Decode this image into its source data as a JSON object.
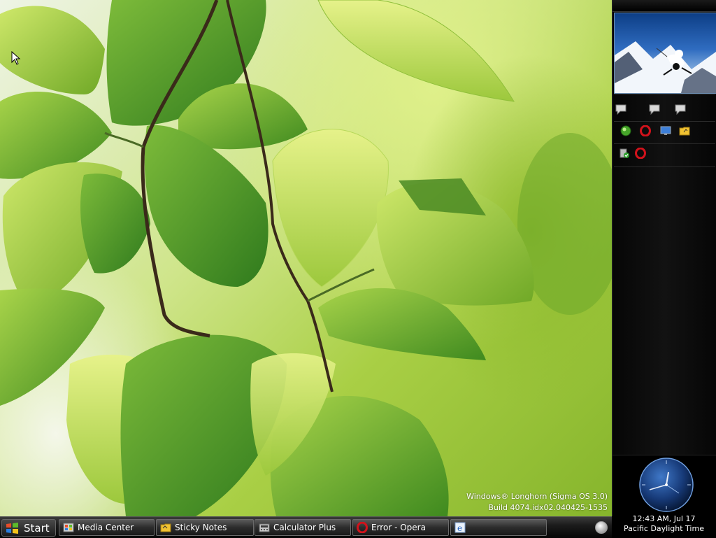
{
  "desktop": {
    "watermark": {
      "line1": "Windows® Longhorn (Sigma OS 3.0)",
      "line2": "Build 4074.idx02.040425-1535"
    }
  },
  "taskbar": {
    "start_label": "Start",
    "tasks": [
      {
        "label": "Media Center",
        "icon": "media-center-icon"
      },
      {
        "label": "Sticky Notes",
        "icon": "sticky-notes-icon"
      },
      {
        "label": "Calculator Plus",
        "icon": "calculator-icon"
      },
      {
        "label": "Error - Opera",
        "icon": "opera-icon"
      },
      {
        "label": "",
        "icon": "internet-explorer-icon"
      }
    ]
  },
  "sidebar": {
    "tiles_row1": [
      "chat-bubble-icon",
      "chat-bubble-icon",
      "chat-bubble-icon"
    ],
    "tiles_row2": [
      "green-orb-icon",
      "opera-icon",
      "monitor-icon",
      "folder-icon"
    ],
    "tiles_row3": [
      "security-icon",
      "opera-icon"
    ],
    "clock": {
      "time": "12:43 AM, Jul 17",
      "zone": "Pacific Daylight Time"
    }
  },
  "colors": {
    "taskbar": "#1b1b1b",
    "sidebar": "#0a0a0a",
    "opera_red": "#d1121b",
    "leaf_green": "#7fb52a"
  }
}
